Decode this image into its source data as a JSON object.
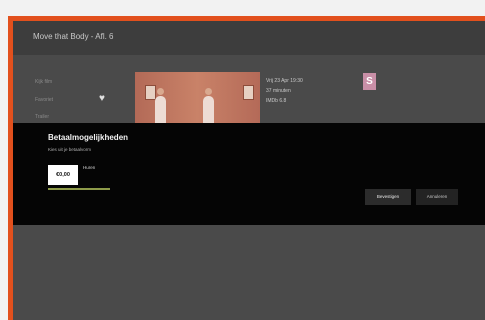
{
  "page": {
    "title": "Move that Body - Afl. 6"
  },
  "sidebar": {
    "items": [
      {
        "label": "Kijk film"
      },
      {
        "label": "Favoriet"
      },
      {
        "label": "Trailer"
      }
    ]
  },
  "episode": {
    "date": "Vrij 23 Apr 19:30",
    "duration": "37 minuten",
    "rating": "IMDb 6.8",
    "badge": "S"
  },
  "dialog": {
    "title": "Betaalmogelijkheden",
    "subtitle": "Kies uit je betaalvorm",
    "price": "€0,00",
    "price_label": "Huren",
    "buttons": {
      "confirm": "Bevestigen",
      "cancel": "Annuleren"
    }
  },
  "colors": {
    "frame": "#e2501d",
    "screen": "#4a4a4a",
    "dialog": "#050505",
    "focus": "#8e9b4a",
    "badge": "#c98fa7"
  }
}
